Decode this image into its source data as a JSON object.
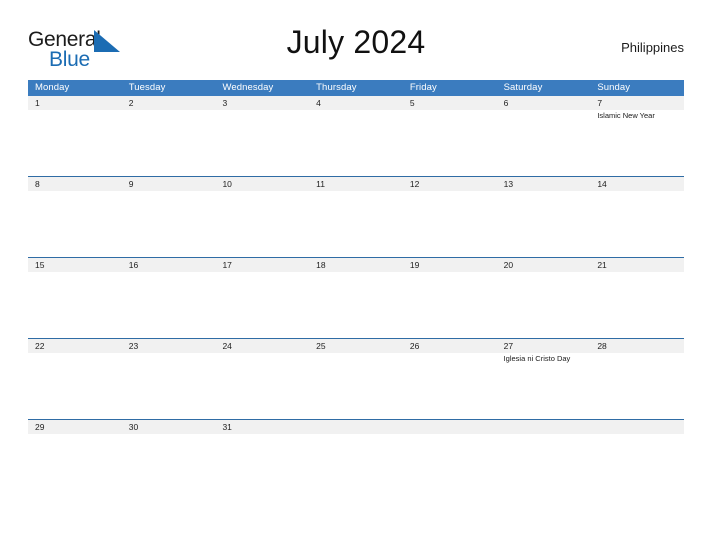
{
  "brand": {
    "name_part1": "General",
    "name_part2": "Blue",
    "triangle_color": "#1b6cb3"
  },
  "header": {
    "title": "July 2024",
    "country": "Philippines"
  },
  "colors": {
    "header_blue": "#3b7cbf",
    "row_line_blue": "#2f6ca5",
    "date_strip_gray": "#f1f1f1",
    "text_dark": "#1a1a1a"
  },
  "calendar": {
    "day_names": [
      "Monday",
      "Tuesday",
      "Wednesday",
      "Thursday",
      "Friday",
      "Saturday",
      "Sunday"
    ],
    "weeks": [
      {
        "days": [
          {
            "num": "1",
            "events": []
          },
          {
            "num": "2",
            "events": []
          },
          {
            "num": "3",
            "events": []
          },
          {
            "num": "4",
            "events": []
          },
          {
            "num": "5",
            "events": []
          },
          {
            "num": "6",
            "events": []
          },
          {
            "num": "7",
            "events": [
              "Islamic New Year"
            ]
          }
        ]
      },
      {
        "days": [
          {
            "num": "8",
            "events": []
          },
          {
            "num": "9",
            "events": []
          },
          {
            "num": "10",
            "events": []
          },
          {
            "num": "11",
            "events": []
          },
          {
            "num": "12",
            "events": []
          },
          {
            "num": "13",
            "events": []
          },
          {
            "num": "14",
            "events": []
          }
        ]
      },
      {
        "days": [
          {
            "num": "15",
            "events": []
          },
          {
            "num": "16",
            "events": []
          },
          {
            "num": "17",
            "events": []
          },
          {
            "num": "18",
            "events": []
          },
          {
            "num": "19",
            "events": []
          },
          {
            "num": "20",
            "events": []
          },
          {
            "num": "21",
            "events": []
          }
        ]
      },
      {
        "days": [
          {
            "num": "22",
            "events": []
          },
          {
            "num": "23",
            "events": []
          },
          {
            "num": "24",
            "events": []
          },
          {
            "num": "25",
            "events": []
          },
          {
            "num": "26",
            "events": []
          },
          {
            "num": "27",
            "events": [
              "Iglesia ni Cristo Day"
            ]
          },
          {
            "num": "28",
            "events": []
          }
        ]
      },
      {
        "days": [
          {
            "num": "29",
            "events": []
          },
          {
            "num": "30",
            "events": []
          },
          {
            "num": "31",
            "events": []
          },
          {
            "num": "",
            "events": []
          },
          {
            "num": "",
            "events": []
          },
          {
            "num": "",
            "events": []
          },
          {
            "num": "",
            "events": []
          }
        ]
      }
    ]
  }
}
